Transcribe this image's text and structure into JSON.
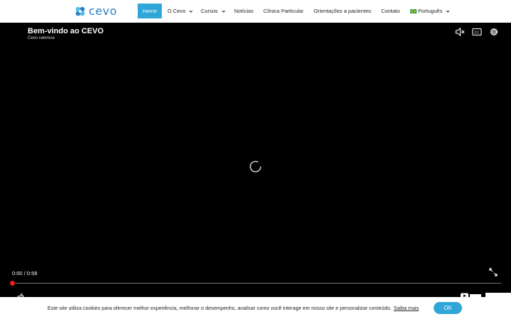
{
  "header": {
    "logo_text": "cevo",
    "nav": [
      {
        "label": "Home",
        "active": true
      },
      {
        "label": "O Cevo",
        "has_dropdown": true
      },
      {
        "label": "Cursos",
        "has_dropdown": true
      },
      {
        "label": "Notícias"
      },
      {
        "label": "Clínica Particular"
      },
      {
        "label": "Orientações a pacientes"
      },
      {
        "label": "Contato"
      }
    ],
    "language": {
      "label": "Português",
      "flag": "brazil-flag-icon"
    }
  },
  "video": {
    "title": "Bem-vindo ao CEVO",
    "channel": "Cevo valencia",
    "time_current": "0:00",
    "time_separator": "/",
    "time_total": "0:58",
    "progress": 0,
    "controls": [
      "mute-icon",
      "captions-icon",
      "settings-icon",
      "fullscreen-icon",
      "share-icon"
    ]
  },
  "cookie_banner": {
    "text": "Este site utiliza cookies para oferecer melhor experiência, melhorar o desempenho, analisar como você interage em nosso site e personalizar conteúdo.",
    "link": "Saiba mais",
    "button": "OK"
  },
  "colors": {
    "accent": "#2fa6d8",
    "logo": "#2f7fc4",
    "progress": "#e62117"
  }
}
